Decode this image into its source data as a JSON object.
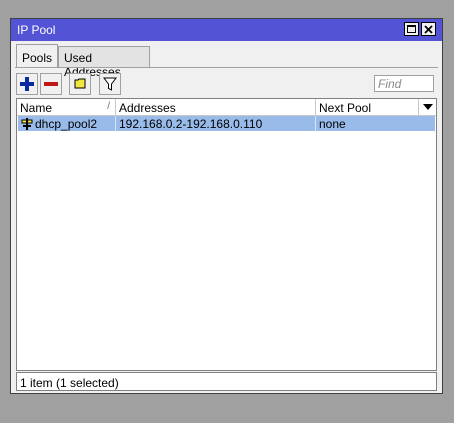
{
  "window": {
    "title": "IP Pool"
  },
  "tabs": [
    {
      "label": "Pools",
      "active": true
    },
    {
      "label": "Used Addresses",
      "active": false
    }
  ],
  "toolbar": {
    "buttons": [
      {
        "name": "add",
        "icon": "plus-icon"
      },
      {
        "name": "remove",
        "icon": "minus-icon"
      },
      {
        "name": "comment",
        "icon": "comment-icon"
      },
      {
        "name": "filter",
        "icon": "filter-icon"
      }
    ],
    "find_placeholder": "Find"
  },
  "table": {
    "columns": [
      "Name",
      "Addresses",
      "Next Pool"
    ],
    "rows": [
      {
        "name": "dhcp_pool2",
        "addresses": "192.168.0.2-192.168.0.110",
        "next_pool": "none",
        "selected": true
      }
    ]
  },
  "status": {
    "text": "1 item (1 selected)"
  },
  "colors": {
    "titlebar": "#5353d5",
    "selected_row": "#99bbea",
    "add_icon": "#0a2aa0",
    "remove_icon": "#c01818",
    "comment_icon": "#f2e640"
  }
}
